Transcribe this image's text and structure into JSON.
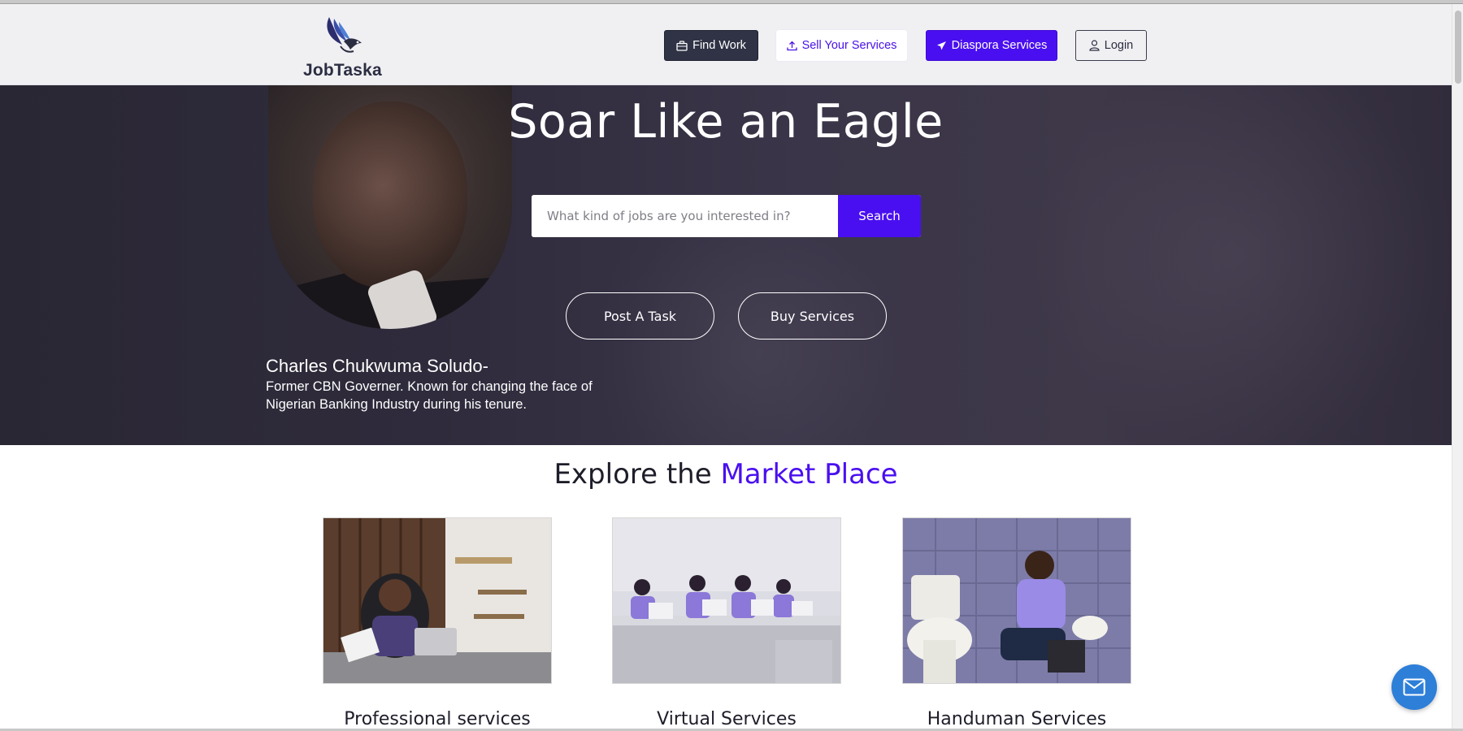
{
  "header": {
    "logo_text": "JobTaska",
    "nav": {
      "find_work": "Find Work",
      "sell_services": "Sell Your Services",
      "diaspora_services": "Diaspora Services",
      "login": "Login"
    }
  },
  "hero": {
    "title": "Soar Like an Eagle",
    "search": {
      "placeholder": "What kind of jobs are you interested in?",
      "value": "",
      "button_label": "Search"
    },
    "buttons": {
      "post_task": "Post A Task",
      "buy_services": "Buy Services"
    },
    "quote": {
      "name": "Charles Chukwuma Soludo-",
      "description": "Former CBN Governer. Known for changing the face of Nigerian Banking Industry during his tenure."
    }
  },
  "market": {
    "title_prefix": "Explore the ",
    "title_accent": "Market Place",
    "cards": [
      {
        "label": "Professional services"
      },
      {
        "label": "Virtual Services"
      },
      {
        "label": "Handuman Services"
      }
    ]
  },
  "colors": {
    "accent": "#4a0ff0",
    "header_bg": "#f0f0f3",
    "dark_button": "#2f3345",
    "chat_button": "#2d7fd8"
  },
  "icons": {
    "find_work": "briefcase-icon",
    "sell_services": "upload-icon",
    "diaspora_services": "plane-icon",
    "login": "user-icon",
    "chat": "envelope-icon"
  }
}
